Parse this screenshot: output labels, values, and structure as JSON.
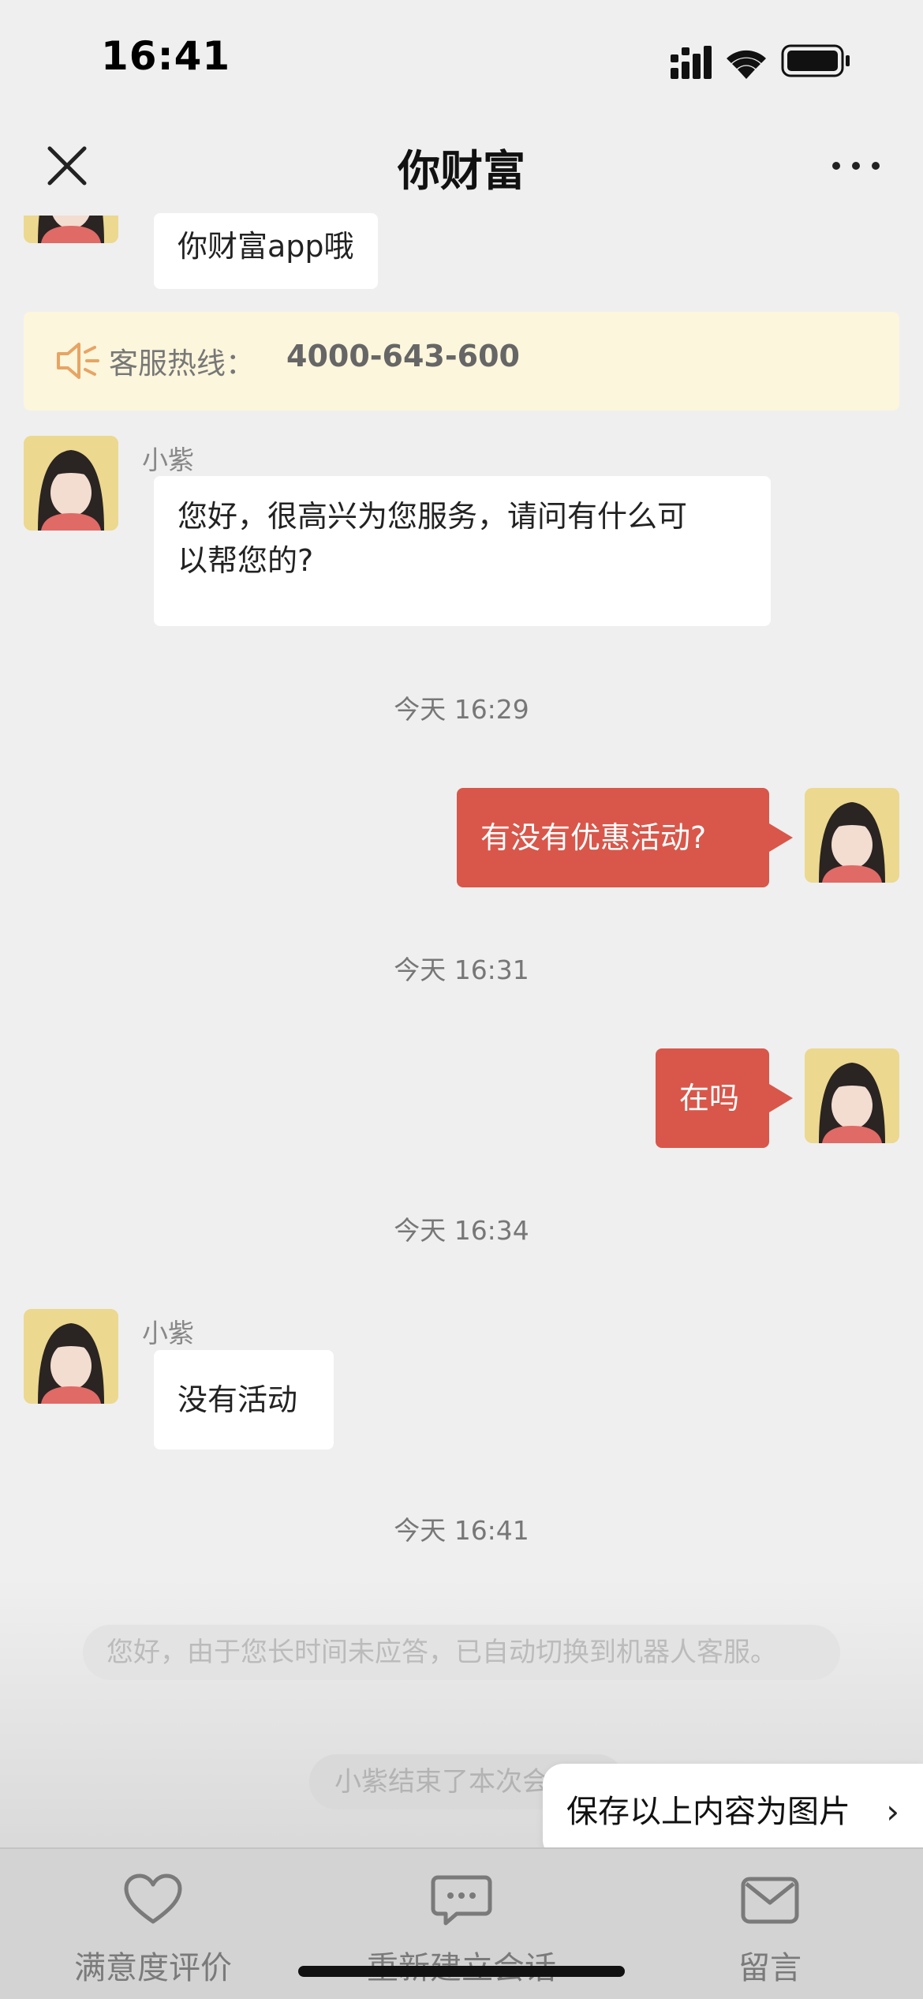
{
  "status_bar": {
    "time": "16:41"
  },
  "nav": {
    "title": "你财富"
  },
  "messages": {
    "partial_incoming": "你财富app哦",
    "hotline_label": "客服热线：",
    "hotline_number": "4000-643-600",
    "agent_name": "小紫",
    "greeting_line1": "您好，很高兴为您服务，请问有什么可",
    "greeting_line2": "以帮您的?",
    "time_1": "今天 16:29",
    "out_1": "有没有优惠活动?",
    "time_2": "今天 16:31",
    "out_2": "在吗",
    "time_3": "今天 16:34",
    "agent_name_2": "小紫",
    "in_reply": "没有活动",
    "time_4": "今天 16:41",
    "system_notice": "您好，由于您长时间未应答，已自动切换到机器人客服。",
    "session_end": "小紫结束了本次会话"
  },
  "save_button": {
    "label": "保存以上内容为图片",
    "chevron": "›"
  },
  "tab_bar": {
    "tabs": [
      {
        "label": "满意度评价",
        "icon": "heart-icon"
      },
      {
        "label": "重新建立会话",
        "icon": "chat-bubble-icon"
      },
      {
        "label": "留言",
        "icon": "envelope-icon"
      }
    ]
  },
  "colors": {
    "outgoing_bubble": "#d8574a",
    "hotline_background": "#fbf6dc",
    "avatar_background": "#ecd88f"
  }
}
